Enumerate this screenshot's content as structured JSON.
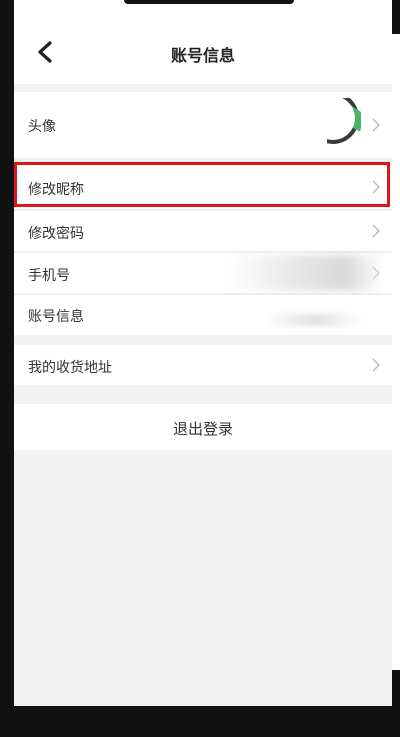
{
  "header": {
    "title": "账号信息",
    "back_icon": "chevron-left-icon"
  },
  "profile_rows": [
    {
      "label": "头像"
    },
    {
      "label": "修改昵称"
    },
    {
      "label": "修改密码"
    },
    {
      "label": "手机号"
    },
    {
      "label": "账号信息"
    }
  ],
  "address_row": {
    "label": "我的收货地址"
  },
  "logout": {
    "label": "退出登录"
  },
  "colors": {
    "highlight": "#e0141b",
    "background": "#f2f2f2",
    "card": "#ffffff",
    "text": "#333333",
    "chevron": "#b5b5b5"
  }
}
